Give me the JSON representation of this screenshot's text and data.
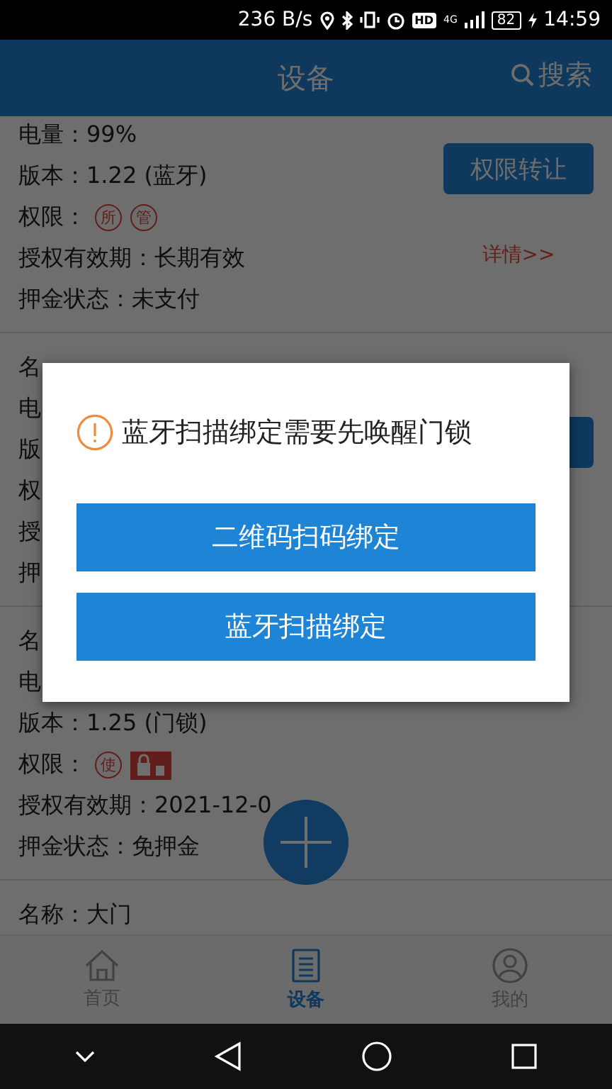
{
  "status_bar": {
    "speed": "236 B/s",
    "hd": "HD",
    "network": "4G",
    "battery": "82",
    "time": "14:59"
  },
  "header": {
    "title": "设备",
    "search": "搜索"
  },
  "cards": [
    {
      "lines": [
        {
          "text": "电量：99%"
        },
        {
          "text": "版本：1.22 (蓝牙)"
        },
        {
          "text": "权限：",
          "badges": [
            {
              "kind": "seal",
              "text": "所"
            },
            {
              "kind": "seal",
              "text": "管"
            }
          ]
        },
        {
          "text": "授权有效期：长期有效"
        },
        {
          "text": "押金状态：未支付"
        }
      ],
      "button": {
        "label": "权限转让"
      },
      "details": "详情>>"
    },
    {
      "lines": [
        {
          "text": "名"
        },
        {
          "text": "电"
        },
        {
          "text": "版"
        },
        {
          "text": "权"
        },
        {
          "text": "授"
        },
        {
          "text": "押"
        }
      ],
      "button": {
        "covered": true
      }
    },
    {
      "lines": [
        {
          "text": "名"
        },
        {
          "text": "电"
        },
        {
          "text": "版本：1.25 (门锁)"
        },
        {
          "text": "权限：",
          "badges": [
            {
              "kind": "seal",
              "text": "使"
            },
            {
              "kind": "lock"
            }
          ]
        },
        {
          "text": "授权有效期：2021-12-0"
        },
        {
          "text": "押金状态：免押金"
        }
      ]
    },
    {
      "lines": [
        {
          "text": "名称：大门"
        }
      ]
    }
  ],
  "tabs": [
    {
      "label": "首页",
      "selected": false
    },
    {
      "label": "设备",
      "selected": true
    },
    {
      "label": "我的",
      "selected": false
    }
  ],
  "dialog": {
    "message": "蓝牙扫描绑定需要先唤醒门锁",
    "buttons": [
      "二维码扫码绑定",
      "蓝牙扫描绑定"
    ]
  }
}
